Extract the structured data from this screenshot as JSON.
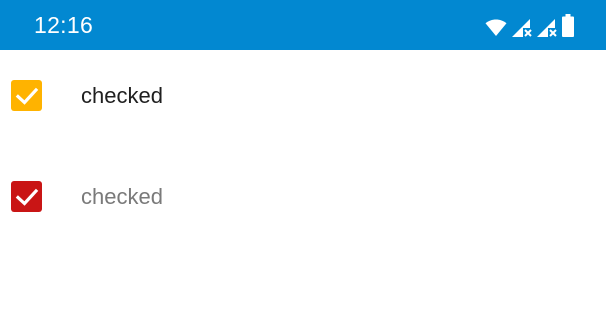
{
  "status_bar": {
    "time": "12:16",
    "background_color": "#0288d1",
    "icons": [
      "wifi-icon",
      "cell-signal-no-data-icon",
      "cell-signal-no-data-icon",
      "battery-icon"
    ]
  },
  "checkboxes": [
    {
      "label": "checked",
      "checked": true,
      "enabled": true,
      "color": "#ffb300",
      "icon": "checkmark-icon"
    },
    {
      "label": "checked",
      "checked": true,
      "enabled": false,
      "color": "#c91515",
      "icon": "checkmark-icon"
    }
  ]
}
